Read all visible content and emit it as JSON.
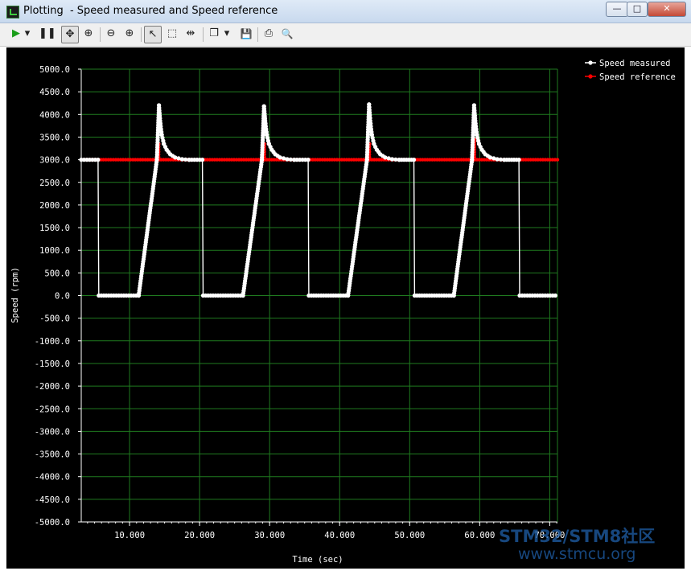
{
  "window": {
    "title": "Plotting  - Speed measured and Speed reference",
    "buttons": {
      "minimize": "—",
      "restore": "□",
      "close": "✕"
    }
  },
  "toolbar": {
    "items": [
      {
        "name": "play-icon",
        "glyph": "▶"
      },
      {
        "name": "dropdown-icon",
        "glyph": "▾"
      },
      {
        "name": "pause-icon",
        "glyph": "❚❚"
      },
      {
        "name": "pan-icon",
        "glyph": "✥"
      },
      {
        "name": "zoom-auto-icon",
        "glyph": "⊕"
      },
      {
        "name": "zoom-out-icon",
        "glyph": "⊖"
      },
      {
        "name": "zoom-in-icon",
        "glyph": "⊕"
      },
      {
        "name": "select-pointer-icon",
        "glyph": "↖"
      },
      {
        "name": "select-rect-icon",
        "glyph": "⬚"
      },
      {
        "name": "cursor-icon",
        "glyph": "⇹"
      },
      {
        "name": "copy-icon",
        "glyph": "❐"
      },
      {
        "name": "dropdown-icon",
        "glyph": "▾"
      },
      {
        "name": "save-icon",
        "glyph": "💾"
      },
      {
        "name": "print-icon",
        "glyph": "⎙"
      },
      {
        "name": "print-preview-icon",
        "glyph": "🔍"
      }
    ]
  },
  "watermark": {
    "line1": "STM32/STM8社区",
    "line2": "www.stmcu.org"
  },
  "chart_data": {
    "type": "line",
    "title": "",
    "xlabel": "Time (sec)",
    "ylabel": "Speed (rpm)",
    "xlim": [
      3.1,
      71.1
    ],
    "ylim": [
      -5000,
      5000
    ],
    "x_ticks": [
      "10.000",
      "20.000",
      "30.000",
      "40.000",
      "50.000",
      "60.000",
      "70.000"
    ],
    "x_tick_values": [
      10,
      20,
      30,
      40,
      50,
      60,
      70
    ],
    "y_ticks": [
      "5000.0",
      "4500.0",
      "4000.0",
      "3500.0",
      "3000.0",
      "2500.0",
      "2000.0",
      "1500.0",
      "1000.0",
      "500.0",
      "0.0",
      "-500.0",
      "-1000.0",
      "-1500.0",
      "-2000.0",
      "-2500.0",
      "-3000.0",
      "-3500.0",
      "-4000.0",
      "-4500.0",
      "-5000.0"
    ],
    "y_tick_values": [
      5000,
      4500,
      4000,
      3500,
      3000,
      2500,
      2000,
      1500,
      1000,
      500,
      0,
      -500,
      -1000,
      -1500,
      -2000,
      -2500,
      -3000,
      -3500,
      -4000,
      -4500,
      -5000
    ],
    "grid": true,
    "legend_position": "top-right",
    "colors": {
      "background": "#000000",
      "grid": "#1f7a1f",
      "axis": "#ffffff",
      "measured": "#ffffff",
      "reference": "#ff0000"
    },
    "series": [
      {
        "name": "Speed measured",
        "color": "#ffffff",
        "x": [
          3.1,
          5.5,
          5.6,
          11.3,
          13.9,
          14.2,
          14.4,
          14.6,
          14.9,
          15.3,
          15.8,
          16.5,
          17.5,
          18.5,
          20.4,
          20.5,
          26.2,
          28.9,
          29.2,
          29.4,
          29.6,
          29.9,
          30.3,
          30.8,
          31.5,
          32.5,
          33.5,
          35.5,
          35.6,
          41.2,
          43.9,
          44.2,
          44.4,
          44.6,
          44.9,
          45.3,
          45.8,
          46.5,
          47.5,
          48.5,
          50.6,
          50.7,
          56.3,
          58.9,
          59.2,
          59.4,
          59.6,
          59.9,
          60.3,
          60.8,
          61.5,
          62.5,
          63.5,
          65.6,
          65.7,
          70.8
        ],
        "y": [
          3000,
          3000,
          0,
          0,
          3000,
          4200,
          3800,
          3550,
          3350,
          3220,
          3120,
          3050,
          3010,
          3000,
          3000,
          0,
          0,
          3000,
          4180,
          3800,
          3550,
          3350,
          3220,
          3120,
          3050,
          3010,
          3000,
          3000,
          0,
          0,
          3000,
          4220,
          3800,
          3550,
          3350,
          3220,
          3120,
          3050,
          3010,
          3000,
          3000,
          0,
          0,
          3000,
          4200,
          3800,
          3550,
          3350,
          3220,
          3120,
          3050,
          3010,
          3000,
          3000,
          0,
          0
        ]
      },
      {
        "name": "Speed reference",
        "color": "#ff0000",
        "x": [
          3.1,
          14.0,
          14.0,
          14.15,
          14.15,
          29.1,
          29.1,
          29.25,
          29.25,
          44.1,
          44.1,
          44.25,
          44.25,
          59.1,
          59.1,
          59.25,
          59.25,
          71.1
        ],
        "y": [
          3000,
          3000,
          3350,
          3350,
          3000,
          3000,
          3350,
          3350,
          3000,
          3000,
          3350,
          3350,
          3000,
          3000,
          3450,
          3450,
          3000,
          3000
        ]
      }
    ]
  }
}
